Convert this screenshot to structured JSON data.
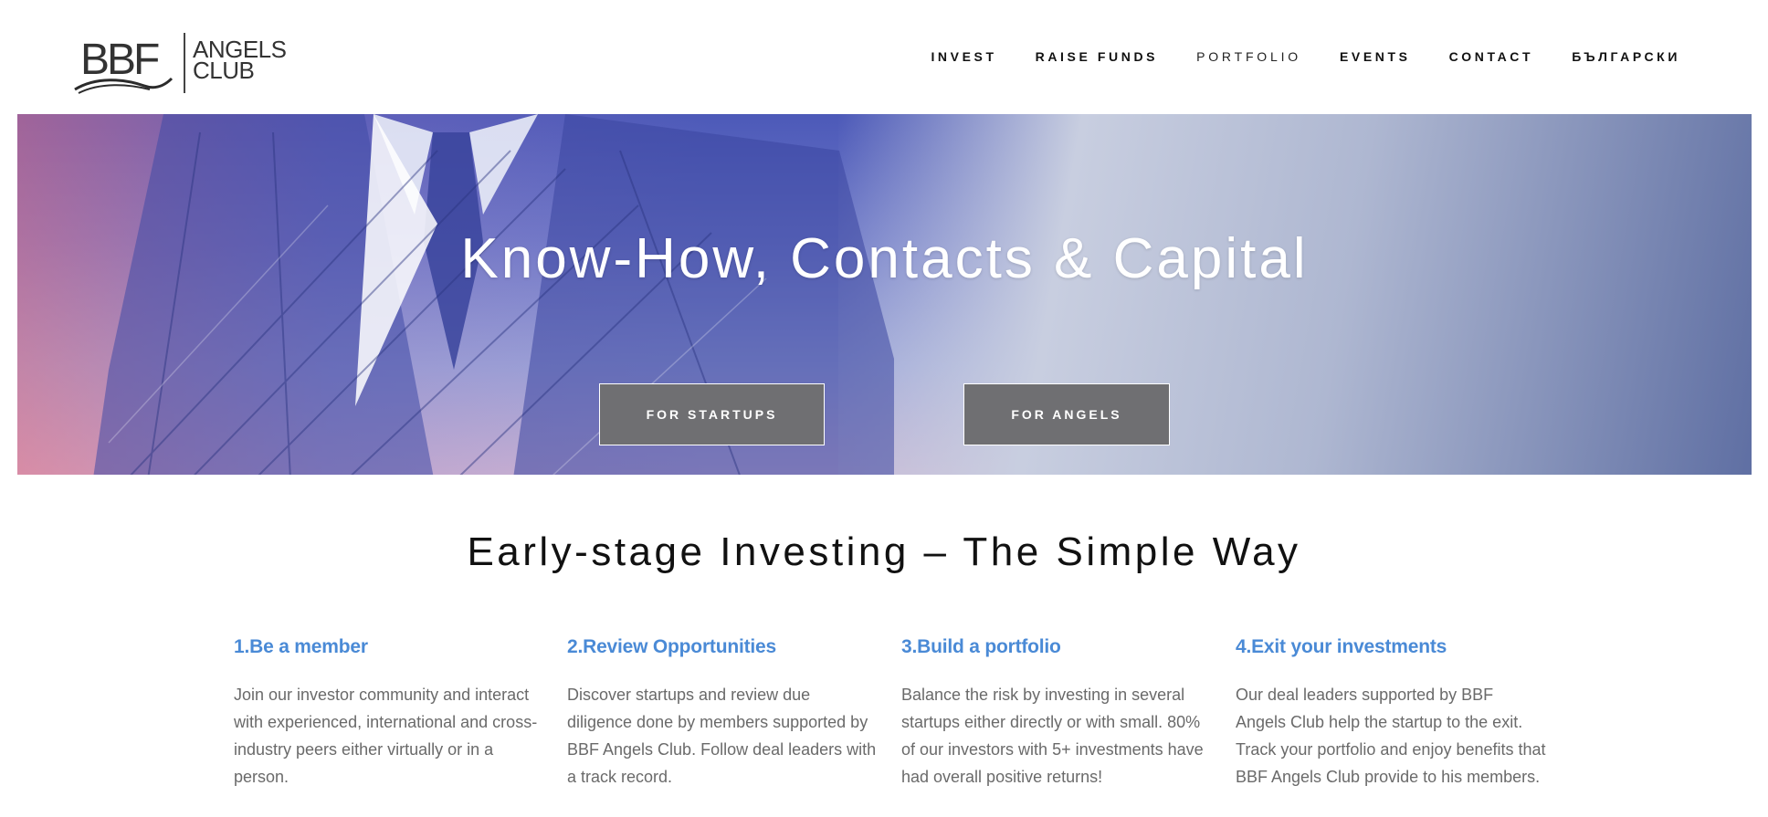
{
  "logo": {
    "brand": "BBF",
    "line1": "ANGELS",
    "line2": "CLUB"
  },
  "nav": {
    "items": [
      {
        "label": "INVEST"
      },
      {
        "label": "RAISE FUNDS"
      },
      {
        "label": "PORTFOLIO",
        "active": true
      },
      {
        "label": "EVENTS"
      },
      {
        "label": "CONTACT"
      },
      {
        "label": "БЪЛГАРСКИ"
      }
    ]
  },
  "hero": {
    "title": "Know-How, Contacts & Capital",
    "buttons": {
      "startups": "FOR STARTUPS",
      "angels": "FOR ANGELS"
    }
  },
  "section": {
    "title": "Early-stage Investing – The Simple Way",
    "steps": [
      {
        "title": "1.Be a member",
        "text": "Join our investor community and interact with experienced, international and cross-industry peers either virtually or in a person."
      },
      {
        "title": "2.Review Opportunities",
        "text": "Discover startups and review due diligence done by members supported by BBF Angels Club. Follow deal leaders with a track record."
      },
      {
        "title": "3.Build a portfolio",
        "text": "Balance the risk by investing in several startups either directly or with small. 80% of our investors with 5+ investments have had overall positive returns!"
      },
      {
        "title": "4.Exit your investments",
        "text": "Our deal leaders supported by BBF Angels Club help the startup to the exit. Track your portfolio and enjoy benefits that BBF Angels Club provide to his members."
      }
    ]
  },
  "colors": {
    "accent": "#4a8ad6",
    "button": "#6f6f72",
    "text_muted": "#6a6a6a"
  }
}
